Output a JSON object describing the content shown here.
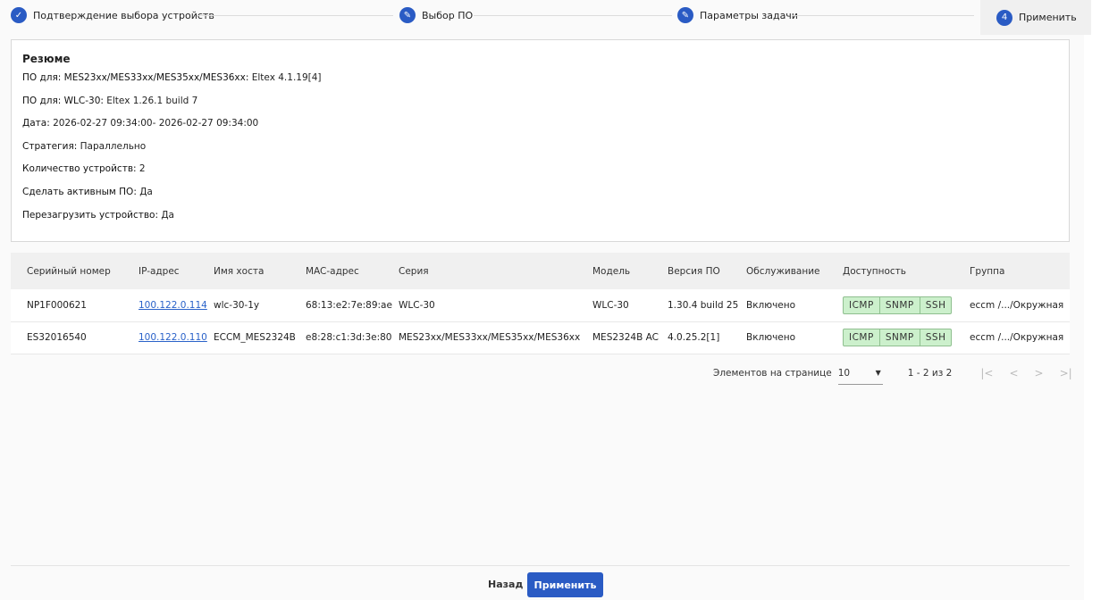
{
  "stepper": {
    "steps": [
      {
        "label": "Подтверждение выбора устройств",
        "icon": "check-icon"
      },
      {
        "label": "Выбор ПО",
        "icon": "pencil-icon"
      },
      {
        "label": "Параметры задачи",
        "icon": "pencil-icon"
      },
      {
        "label": "Применить",
        "number": "4"
      }
    ]
  },
  "summary": {
    "title": "Резюме",
    "rows": [
      {
        "label": "ПО для: MES23xx/MES33xx/MES35xx/MES36xx:",
        "value": " Eltex 4.1.19[4]"
      },
      {
        "label": "ПО для: WLC-30:",
        "value": " Eltex 1.26.1 build 7"
      },
      {
        "label": "Дата:",
        "value": " 2026-02-27 09:34:00- 2026-02-27 09:34:00"
      },
      {
        "label": "Стратегия:",
        "value": " Параллельно"
      },
      {
        "label": "Количество устройств:",
        "value": " 2"
      },
      {
        "label": "Сделать активным ПО:",
        "value": " Да"
      },
      {
        "label": "Перезагрузить устройство:",
        "value": " Да"
      }
    ]
  },
  "table": {
    "headers": [
      "Серийный номер",
      "IP-адрес",
      "Имя хоста",
      "MAC-адрес",
      "Серия",
      "Модель",
      "Версия ПО",
      "Обслуживание",
      "Доступность",
      "Группа"
    ],
    "rows": [
      {
        "serial": "NP1F000621",
        "ip": "100.122.0.114",
        "host": "wlc-30-1y",
        "mac": "68:13:e2:7e:89:ae",
        "series": "WLC-30",
        "model": "WLC-30",
        "version": "1.30.4 build 25",
        "service": "Включено",
        "avail": [
          "ICMP",
          "SNMP",
          "SSH"
        ],
        "group": "eccm /.../Окружная"
      },
      {
        "serial": "ES32016540",
        "ip": "100.122.0.110",
        "host": "ECCM_MES2324B",
        "mac": "e8:28:c1:3d:3e:80",
        "series": "MES23xx/MES33xx/MES35xx/MES36xx",
        "model": "MES2324B AC",
        "version": "4.0.25.2[1]",
        "service": "Включено",
        "avail": [
          "ICMP",
          "SNMP",
          "SSH"
        ],
        "group": "eccm /.../Окружная"
      }
    ]
  },
  "paginator": {
    "label": "Элементов на странице",
    "page_size": "10",
    "range": "1 - 2 из 2"
  },
  "footer": {
    "back": "Назад",
    "apply": "Применить"
  },
  "colors": {
    "accent": "#2a5bc4",
    "badge": "#ccf0cc"
  }
}
